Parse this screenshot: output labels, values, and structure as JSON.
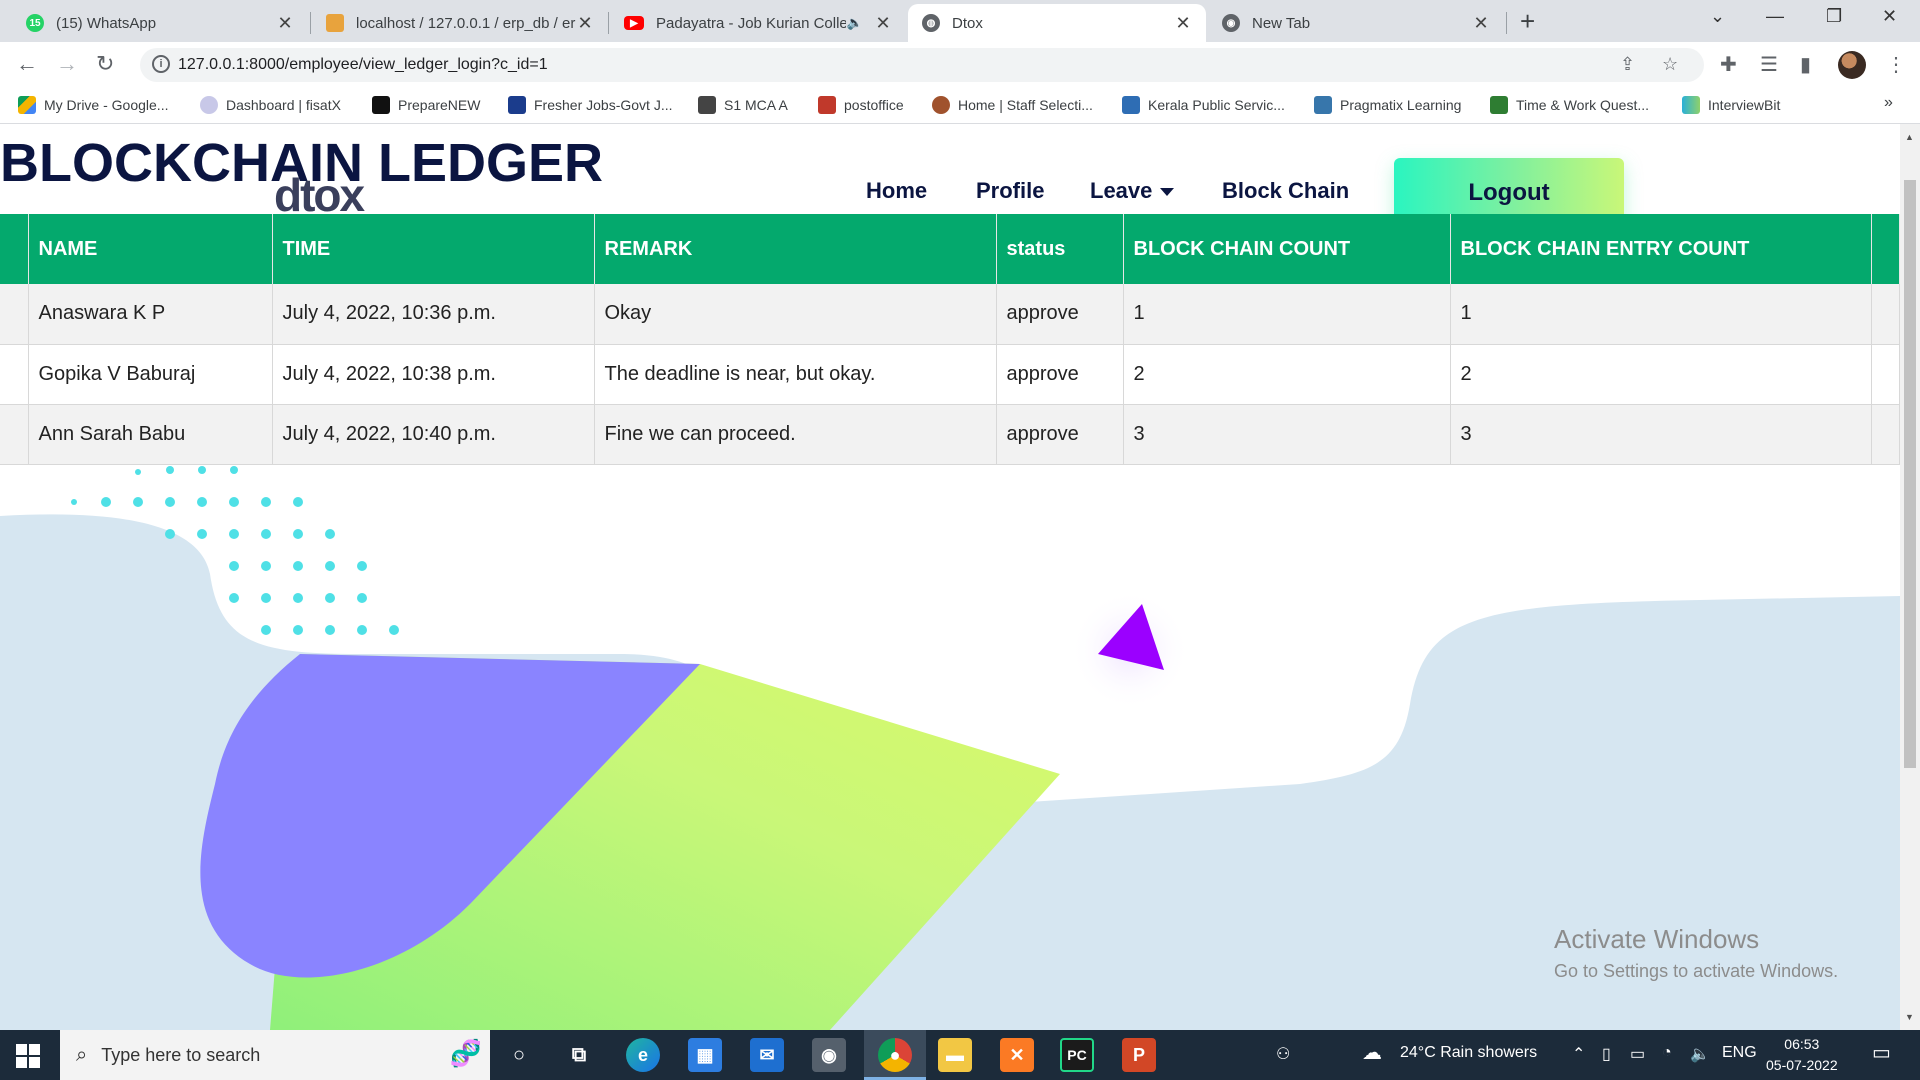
{
  "browser": {
    "tabs": [
      {
        "label": "(15) WhatsApp",
        "favicon": "whatsapp-icon",
        "badge": "15"
      },
      {
        "label": "localhost / 127.0.0.1 / erp_db / er",
        "favicon": "phpmyadmin-icon"
      },
      {
        "label": "Padayatra - Job Kurian Colle",
        "favicon": "youtube-icon"
      },
      {
        "label": "Dtox",
        "favicon": "globe-icon",
        "active": true
      },
      {
        "label": "New Tab",
        "favicon": "chrome-icon"
      }
    ],
    "url": "127.0.0.1:8000/employee/view_ledger_login?c_id=1",
    "bookmarks": [
      "My Drive - Google...",
      "Dashboard | fisatX",
      "PrepareNEW",
      "Fresher Jobs-Govt J...",
      "S1 MCA A",
      "postoffice",
      "Home | Staff Selecti...",
      "Kerala Public Servic...",
      "Pragmatix Learning",
      "Time & Work Quest...",
      "InterviewBit"
    ]
  },
  "page": {
    "title": "BLOCKCHAIN LEDGER",
    "logo": "dtox",
    "nav": {
      "home": "Home",
      "profile": "Profile",
      "leave": "Leave",
      "blockchain": "Block Chain",
      "logout": "Logout"
    },
    "table": {
      "headers": [
        "NAME",
        "TIME",
        "REMARK",
        "status",
        "BLOCK CHAIN COUNT",
        "BLOCK CHAIN ENTRY COUNT"
      ],
      "rows": [
        [
          "Anaswara K P",
          "July 4, 2022, 10:36 p.m.",
          "Okay",
          "approve",
          "1",
          "1"
        ],
        [
          "Gopika V Baburaj",
          "July 4, 2022, 10:38 p.m.",
          "The deadline is near, but okay.",
          "approve",
          "2",
          "2"
        ],
        [
          "Ann Sarah Babu",
          "July 4, 2022, 10:40 p.m.",
          "Fine we can proceed.",
          "approve",
          "3",
          "3"
        ]
      ]
    },
    "watermark": {
      "line1": "Activate Windows",
      "line2": "Go to Settings to activate Windows."
    },
    "colors": {
      "header_green": "#04a96d",
      "title_navy": "#0b1541",
      "blob_purple": "#8a84ff",
      "blob_lime": "#c9f778",
      "triangle_violet": "#9b00ff",
      "dots_cyan": "#4fe0e6"
    }
  },
  "taskbar": {
    "search_placeholder": "Type here to search",
    "weather": "24°C  Rain showers",
    "language": "ENG",
    "time": "06:53",
    "date": "05-07-2022"
  }
}
